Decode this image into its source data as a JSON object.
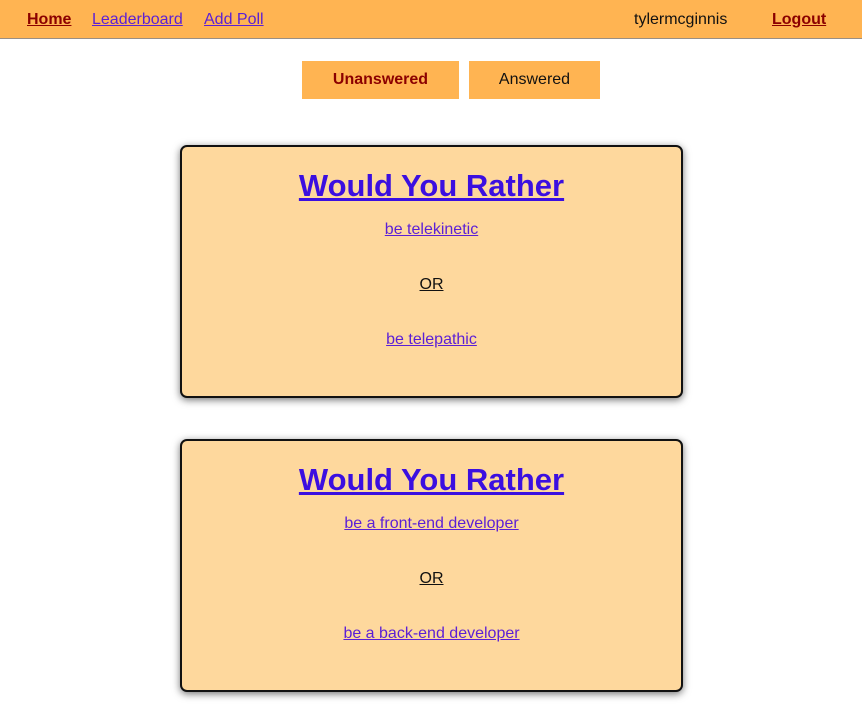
{
  "nav": {
    "home": "Home",
    "leaderboard": "Leaderboard",
    "add_poll": "Add Poll",
    "username": "tylermcginnis",
    "logout": "Logout"
  },
  "tabs": {
    "unanswered": "Unanswered",
    "answered": "Answered"
  },
  "polls": [
    {
      "title": "Would You Rather",
      "option_one": "be telekinetic",
      "separator": "OR",
      "option_two": "be telepathic"
    },
    {
      "title": "Would You Rather",
      "option_one": "be a front-end developer",
      "separator": "OR",
      "option_two": "be a back-end developer"
    }
  ],
  "colors": {
    "nav_background": "#ffb452",
    "card_background": "#fed89d",
    "active_text": "#8b0000",
    "link": "#5b1fd6"
  }
}
